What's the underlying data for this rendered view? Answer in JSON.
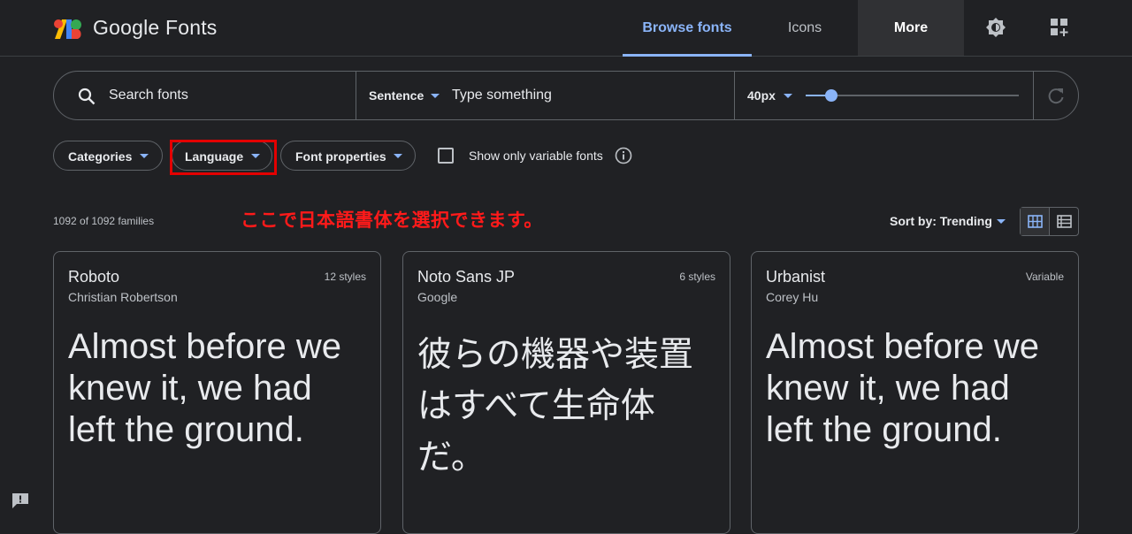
{
  "header": {
    "logo_text": "Google Fonts",
    "tabs": [
      {
        "label": "Browse fonts",
        "active": true
      },
      {
        "label": "Icons",
        "active": false
      },
      {
        "label": "More",
        "active": false
      }
    ],
    "icons": [
      "theme-brightness-icon",
      "apps-grid-add-icon"
    ]
  },
  "search": {
    "placeholder": "Search fonts",
    "preview_mode": "Sentence",
    "preview_placeholder": "Type something",
    "size_label": "40px",
    "size_fraction": 0.12
  },
  "filters": {
    "categories": "Categories",
    "language": "Language",
    "font_properties": "Font properties",
    "variable_only_label": "Show only variable fonts",
    "variable_only_checked": false
  },
  "results": {
    "count": "1092 of 1092 families",
    "annotation": "ここで日本語書体を選択できます。",
    "sort_label": "Sort by: Trending"
  },
  "cards": [
    {
      "name": "Roboto",
      "author": "Christian Robertson",
      "styles": "12 styles",
      "sample_lines": [
        "Almost before we",
        "knew it, we had",
        "left the ground."
      ]
    },
    {
      "name": "Noto Sans JP",
      "author": "Google",
      "styles": "6 styles",
      "sample_lines": [
        "彼らの機器や装置",
        "はすべて生命体",
        "だ。"
      ]
    },
    {
      "name": "Urbanist",
      "author": "Corey Hu",
      "styles": "Variable",
      "sample_lines": [
        "Almost before we",
        "knew it, we had",
        "left the ground."
      ]
    }
  ],
  "colors": {
    "background": "#202124",
    "accent": "#8ab4f8",
    "border": "#5f6368",
    "annotation_red": "#ff1a1a"
  }
}
